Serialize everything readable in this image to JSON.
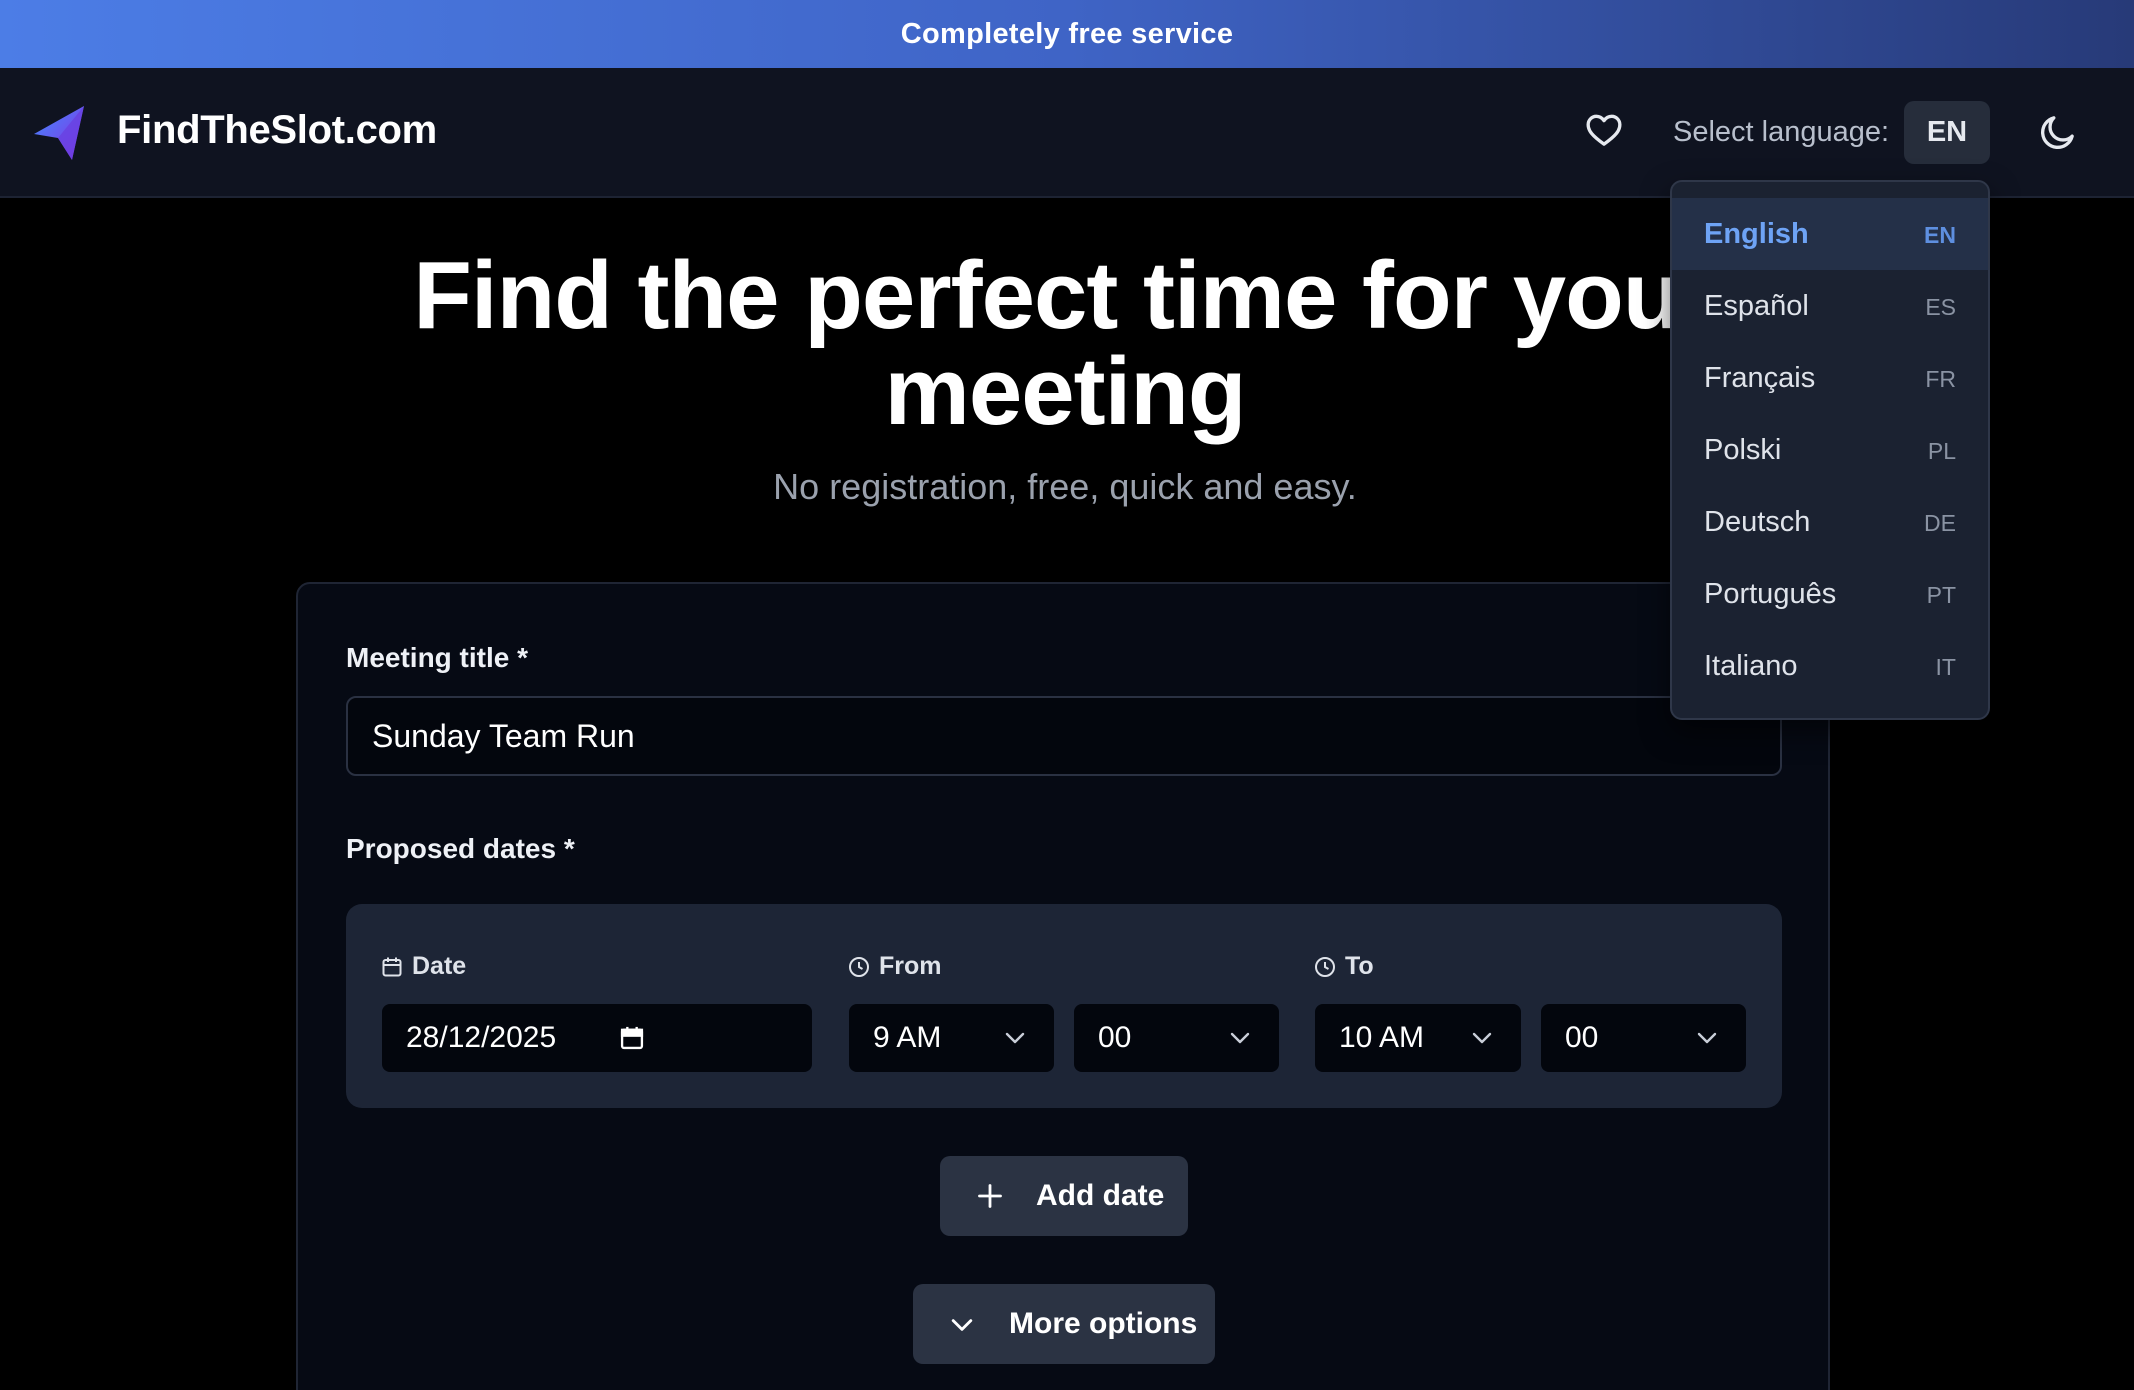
{
  "banner": {
    "text": "Completely free service"
  },
  "header": {
    "brand": "FindTheSlot.com",
    "language_label": "Select language:",
    "language_current": "EN"
  },
  "hero": {
    "title": "Find the perfect time for your meeting",
    "subtitle": "No registration, free, quick and easy."
  },
  "form": {
    "meeting_title_label": "Meeting title *",
    "meeting_title_value": "Sunday Team Run",
    "proposed_dates_label": "Proposed dates *",
    "date_label": "Date",
    "date_value": "28/12/2025",
    "from_label": "From",
    "from_hour": "9 AM",
    "from_minute": "00",
    "to_label": "To",
    "to_hour": "10 AM",
    "to_minute": "00",
    "add_date_label": "Add date",
    "more_options_label": "More options"
  },
  "language_menu": {
    "items": [
      {
        "name": "English",
        "code": "EN",
        "active": true
      },
      {
        "name": "Español",
        "code": "ES"
      },
      {
        "name": "Français",
        "code": "FR"
      },
      {
        "name": "Polski",
        "code": "PL"
      },
      {
        "name": "Deutsch",
        "code": "DE"
      },
      {
        "name": "Português",
        "code": "PT"
      },
      {
        "name": "Italiano",
        "code": "IT"
      }
    ]
  },
  "colors": {
    "accent": "#6ea3f5",
    "banner_start": "#4c7de6",
    "banner_end": "#273a78",
    "header_bg": "#0f1320",
    "panel_bg": "#1d2536"
  },
  "icons": {
    "logo": "paper-plane-icon",
    "favorite": "heart-icon",
    "theme": "moon-icon",
    "date": "calendar-icon",
    "time": "clock-icon",
    "select": "chevron-down-icon",
    "add": "plus-icon"
  }
}
